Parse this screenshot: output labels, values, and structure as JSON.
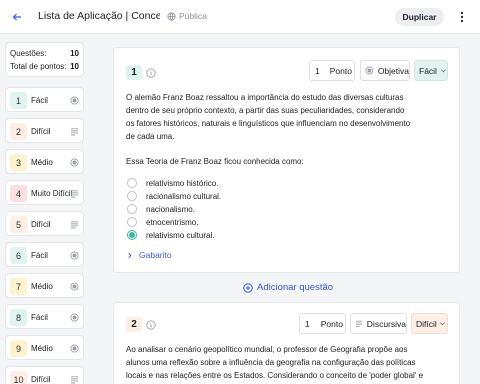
{
  "header": {
    "title": "Lista de Aplicação | Conceit...",
    "visibility": "Pública",
    "duplicate_label": "Duplicar"
  },
  "summary": {
    "questions_label": "Questões:",
    "questions_value": "10",
    "points_label": "Total de pontos:",
    "points_value": "10"
  },
  "questions_nav": [
    {
      "num": "1",
      "level": "Fácil",
      "kind": "radio"
    },
    {
      "num": "2",
      "level": "Difícil",
      "kind": "lines"
    },
    {
      "num": "3",
      "level": "Médio",
      "kind": "radio"
    },
    {
      "num": "4",
      "level": "Muito Difícil",
      "kind": "lines"
    },
    {
      "num": "5",
      "level": "Difícil",
      "kind": "lines"
    },
    {
      "num": "6",
      "level": "Fácil",
      "kind": "radio"
    },
    {
      "num": "7",
      "level": "Médio",
      "kind": "radio"
    },
    {
      "num": "8",
      "level": "Fácil",
      "kind": "radio"
    },
    {
      "num": "9",
      "level": "Médio",
      "kind": "radio"
    },
    {
      "num": "10",
      "level": "Difícil",
      "kind": "lines"
    }
  ],
  "q1": {
    "num": "1",
    "points_value": "1",
    "points_label": "Ponto",
    "type_label": "Objetiva",
    "level_label": "Fácil",
    "text_paragraph": "O alemão Franz Boaz ressaltou a importância do estudo das diversas culturas dentro de seu próprio contexto, a partir das suas peculiaridades, considerando os fatores históricos, naturais e linguísticos que influenciam no desenvolvimento de cada uma.",
    "text_question": "Essa Teoria de Franz Boaz ficou conhecida como:",
    "options": [
      {
        "label": "relativismo histórico.",
        "selected": false
      },
      {
        "label": "racionalismo cultural.",
        "selected": false
      },
      {
        "label": "nacionalismo.",
        "selected": false
      },
      {
        "label": "etnocentrismo.",
        "selected": false
      },
      {
        "label": "relativismo cultural.",
        "selected": true
      }
    ],
    "gabarito_label": "Gabarito"
  },
  "add_question_label": "Adicionar questão",
  "q2": {
    "num": "2",
    "points_value": "1",
    "points_label": "Ponto",
    "type_label": "Discursiva",
    "level_label": "Difícil",
    "text_paragraph": "Ao analisar o cenário geopolítico mundial, o professor de Geografia propõe aos alunos uma reflexão sobre a influência da geografia na configuração das políticas locais e nas relações entre os Estados. Considerando o conceito de 'poder global' e as teorias"
  },
  "colors": {
    "accent": "#3a5ad0",
    "selected": "#3ab79b",
    "facil_bg": "#e0f3ef",
    "dificil_bg": "#fdeee6"
  }
}
